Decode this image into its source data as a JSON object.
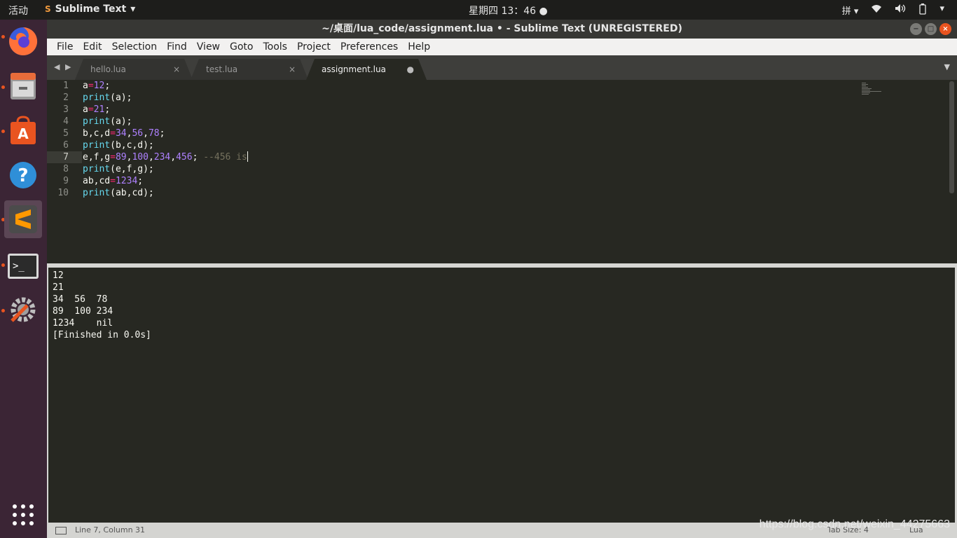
{
  "topbar": {
    "activities": "活动",
    "app_name": "Sublime Text",
    "clock": "星期四 13：46",
    "input_method": "拼"
  },
  "window": {
    "title": "~/桌面/lua_code/assignment.lua • - Sublime Text (UNREGISTERED)"
  },
  "menu": [
    "File",
    "Edit",
    "Selection",
    "Find",
    "View",
    "Goto",
    "Tools",
    "Project",
    "Preferences",
    "Help"
  ],
  "tabs": [
    {
      "label": "hello.lua",
      "state": "×"
    },
    {
      "label": "test.lua",
      "state": "×"
    },
    {
      "label": "assignment.lua",
      "state": "●"
    }
  ],
  "editor": {
    "line_numbers": [
      "1",
      "2",
      "3",
      "4",
      "5",
      "6",
      "7",
      "8",
      "9",
      "10"
    ],
    "current_line": 7
  },
  "output": {
    "lines": [
      "12",
      "21",
      "34  56  78",
      "89  100 234",
      "1234    nil",
      "[Finished in 0.0s]"
    ]
  },
  "status": {
    "position": "Line 7, Column 31",
    "tab_size": "Tab Size: 4",
    "syntax": "Lua"
  },
  "watermark": "https://blog.csdn.net/weixin_44275663",
  "colors": {
    "accent": "#e95420",
    "editor_bg": "#272822",
    "keyword": "#f92672",
    "function": "#66d9ef",
    "number": "#ae81ff",
    "comment": "#75715e"
  }
}
